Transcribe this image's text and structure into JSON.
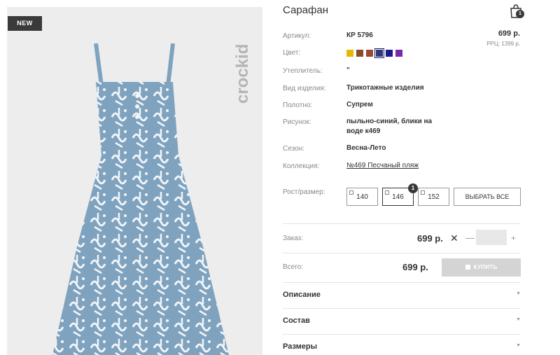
{
  "badge": "NEW",
  "brand": "crockid",
  "title": "Сарафан",
  "cart": {
    "count": "1"
  },
  "price": "699 р.",
  "rrp": "РРЦ: 1399 р.",
  "specs": {
    "article_label": "Артикул:",
    "article_value": "КР 5796",
    "color_label": "Цвет:",
    "insulation_label": "Утеплитель:",
    "insulation_value": "\"",
    "type_label": "Вид изделия:",
    "type_value": "Трикотажные изделия",
    "fabric_label": "Полотно:",
    "fabric_value": "Супрем",
    "pattern_label": "Рисунок:",
    "pattern_value_line1": "пыльно-синий, блики на",
    "pattern_value_line2": "воде к469",
    "season_label": "Сезон:",
    "season_value": "Весна-Лето",
    "collection_label": "Коллекция:",
    "collection_value": "№469 Песчаный пляж"
  },
  "colors": [
    "#e8b800",
    "#8b4a2b",
    "#9a4a34",
    "#2a3a7a",
    "#1a1a8e",
    "#7a2aa8"
  ],
  "sizes": {
    "label": "Рост/размер:",
    "options": [
      "140",
      "146",
      "152"
    ],
    "selected_count": "1",
    "select_all": "ВЫБРАТЬ ВСЕ"
  },
  "order": {
    "label": "Заказ:",
    "price": "699 р.",
    "remove": "✕",
    "minus": "—",
    "plus": "+",
    "quantity": ""
  },
  "total": {
    "label": "Всего:",
    "price": "699 р.",
    "buy_button": "КУПИТЬ"
  },
  "accordions": [
    "Описание",
    "Состав",
    "Размеры"
  ]
}
